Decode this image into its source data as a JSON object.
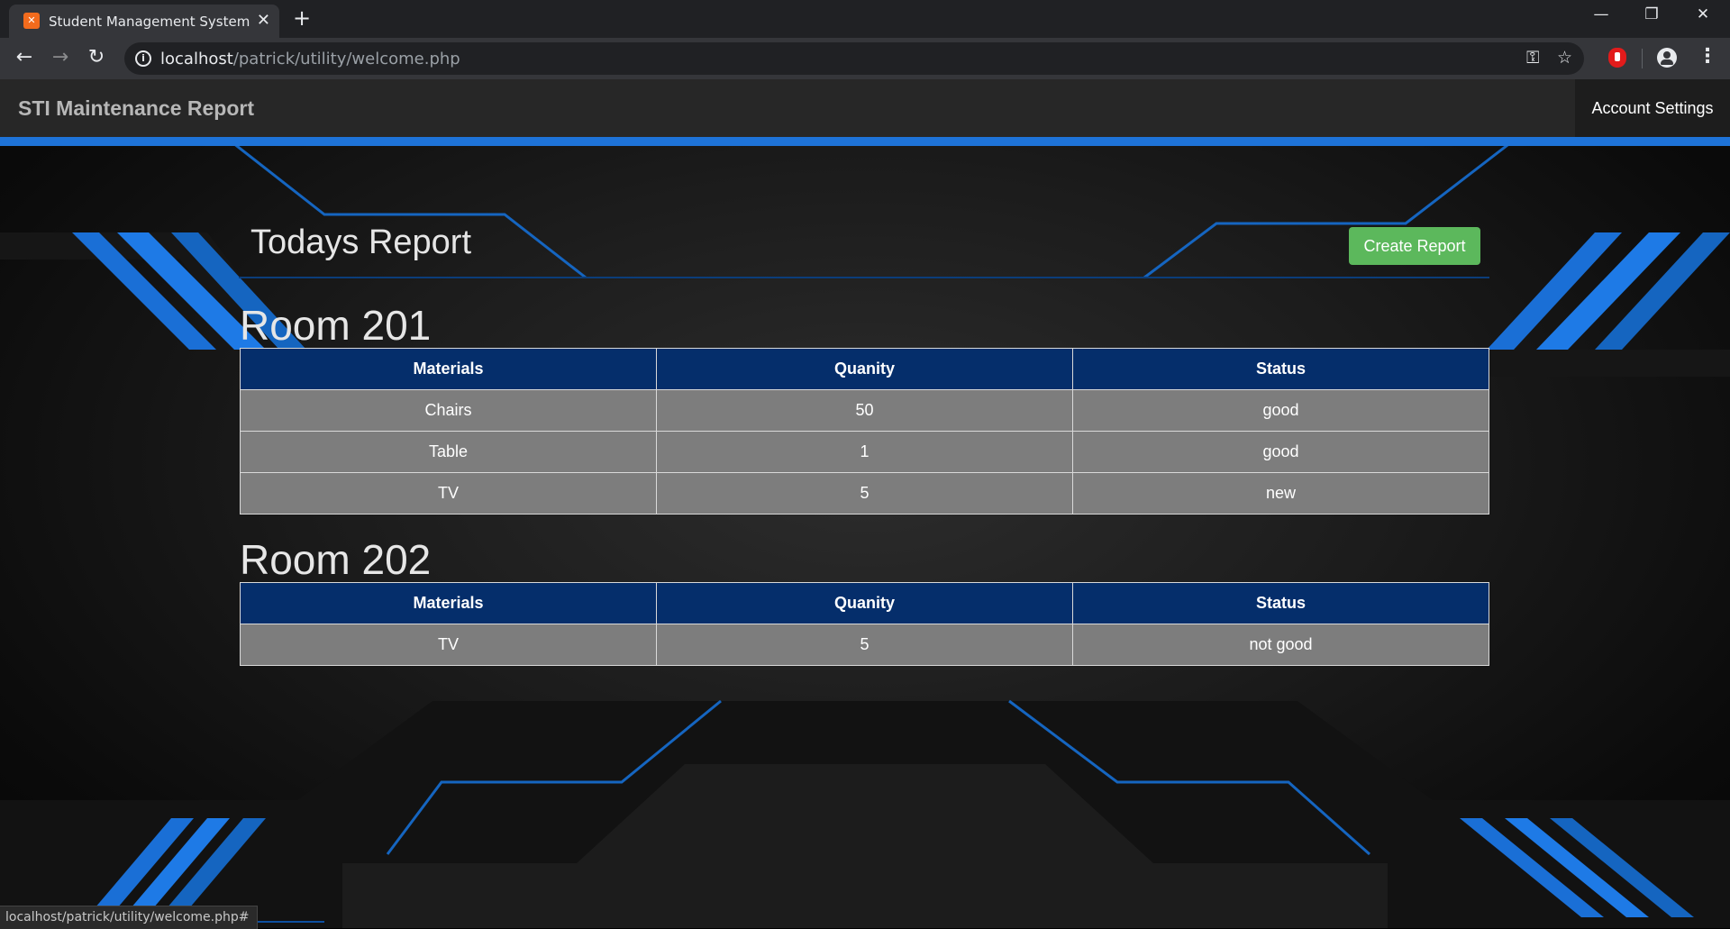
{
  "browser": {
    "tab_title": "Student Management System",
    "favicon": "xampp-icon",
    "url_host": "localhost",
    "url_path": "/patrick/utility/welcome.php",
    "status_url": "localhost/patrick/utility/welcome.php#"
  },
  "navbar": {
    "brand": "STI Maintenance Report",
    "account_settings": "Account Settings"
  },
  "main": {
    "heading": "Todays Report",
    "create_button": "Create Report"
  },
  "rooms": [
    {
      "title": "Room 201",
      "headers": [
        "Materials",
        "Quanity",
        "Status"
      ],
      "rows": [
        [
          "Chairs",
          "50",
          "good"
        ],
        [
          "Table",
          "1",
          "good"
        ],
        [
          "TV",
          "5",
          "new"
        ]
      ]
    },
    {
      "title": "Room 202",
      "headers": [
        "Materials",
        "Quanity",
        "Status"
      ],
      "rows": [
        [
          "TV",
          "5",
          "not good"
        ]
      ]
    }
  ],
  "colors": {
    "accent": "#1e73d8",
    "table_header": "#052e6b",
    "table_cell": "#7d7d7d",
    "button_green": "#5cb85c"
  }
}
